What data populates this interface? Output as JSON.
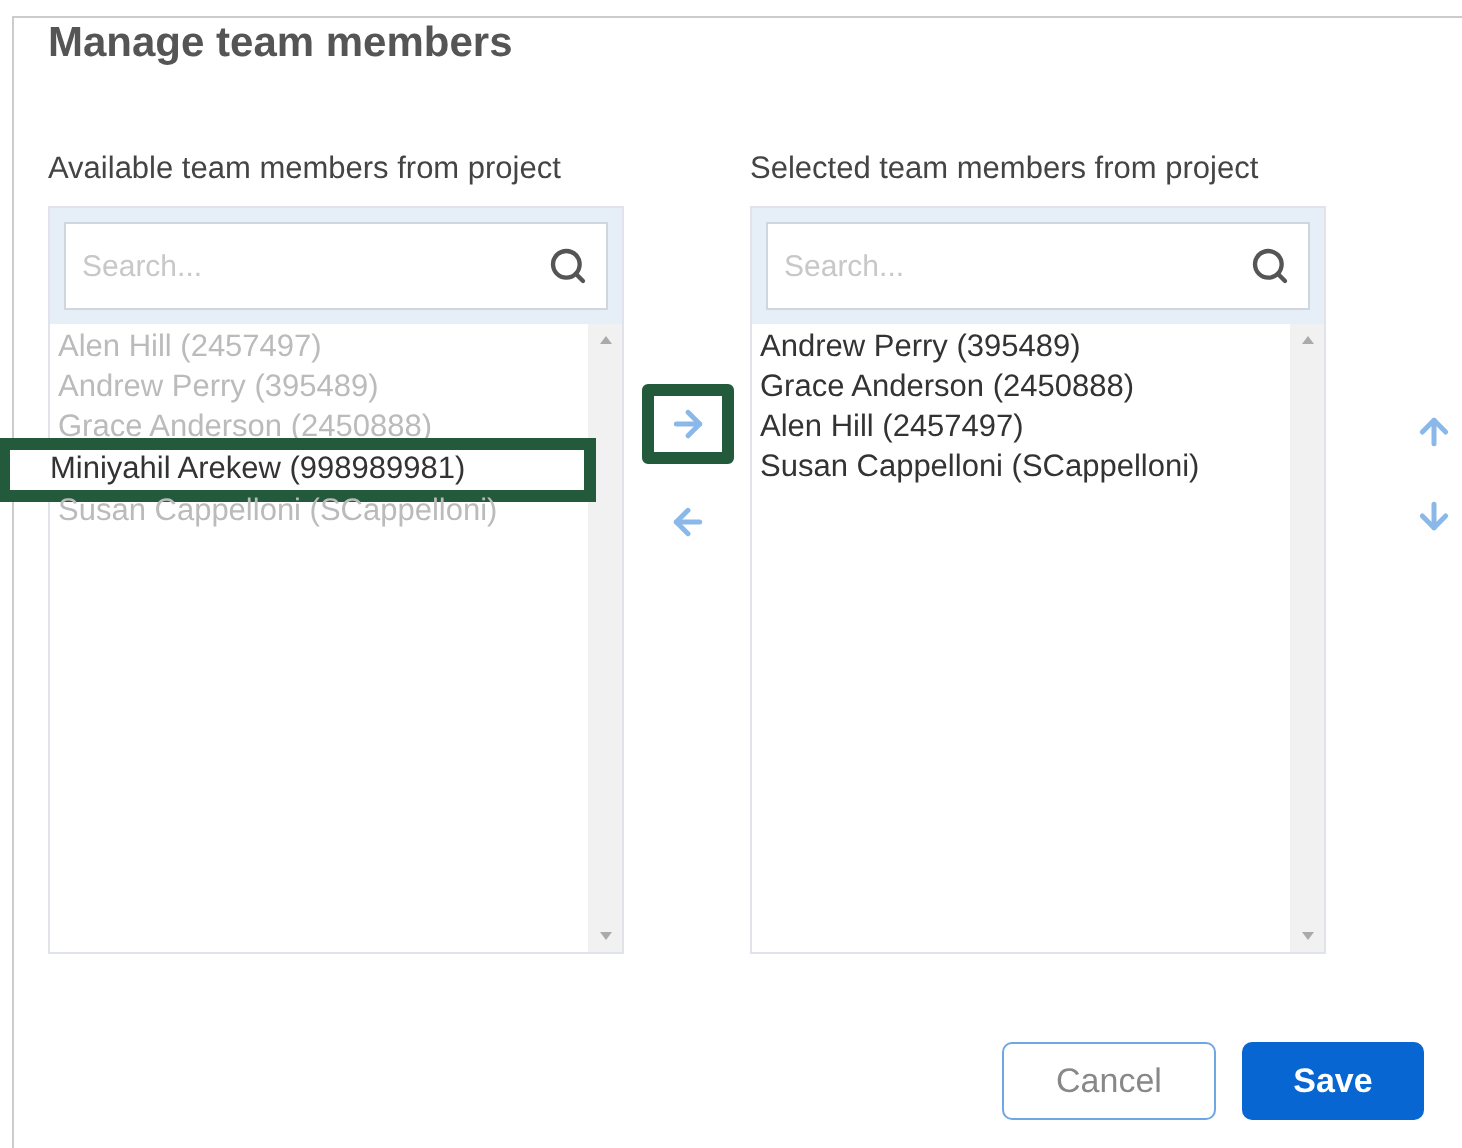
{
  "title": "Manage team members",
  "available": {
    "label": "Available team members from project",
    "search": {
      "placeholder": "Search..."
    },
    "items": [
      {
        "name": "Alen Hill (2457497)",
        "disabled": true,
        "highlighted": false
      },
      {
        "name": "Andrew Perry (395489)",
        "disabled": true,
        "highlighted": false
      },
      {
        "name": "Grace Anderson (2450888)",
        "disabled": true,
        "highlighted": false
      },
      {
        "name": "Miniyahil Arekew (998989981)",
        "disabled": false,
        "highlighted": true
      },
      {
        "name": "Susan Cappelloni (SCappelloni)",
        "disabled": true,
        "highlighted": false
      }
    ]
  },
  "transfer": [
    {
      "kind": "right",
      "highlighted": true
    },
    {
      "kind": "left",
      "highlighted": false
    }
  ],
  "selected": {
    "label": "Selected team members from project",
    "search": {
      "placeholder": "Search..."
    },
    "items": [
      {
        "name": "Andrew Perry (395489)",
        "disabled": false,
        "highlighted": false
      },
      {
        "name": "Grace Anderson (2450888)",
        "disabled": false,
        "highlighted": false
      },
      {
        "name": "Alen Hill (2457497)",
        "disabled": false,
        "highlighted": false
      },
      {
        "name": "Susan Cappelloni (SCappelloni)",
        "disabled": false,
        "highlighted": false
      }
    ]
  },
  "order": [
    {
      "kind": "up"
    },
    {
      "kind": "down"
    }
  ],
  "buttons": [
    {
      "label": "Cancel",
      "kind": "secondary"
    },
    {
      "label": "Save",
      "kind": "primary"
    }
  ]
}
